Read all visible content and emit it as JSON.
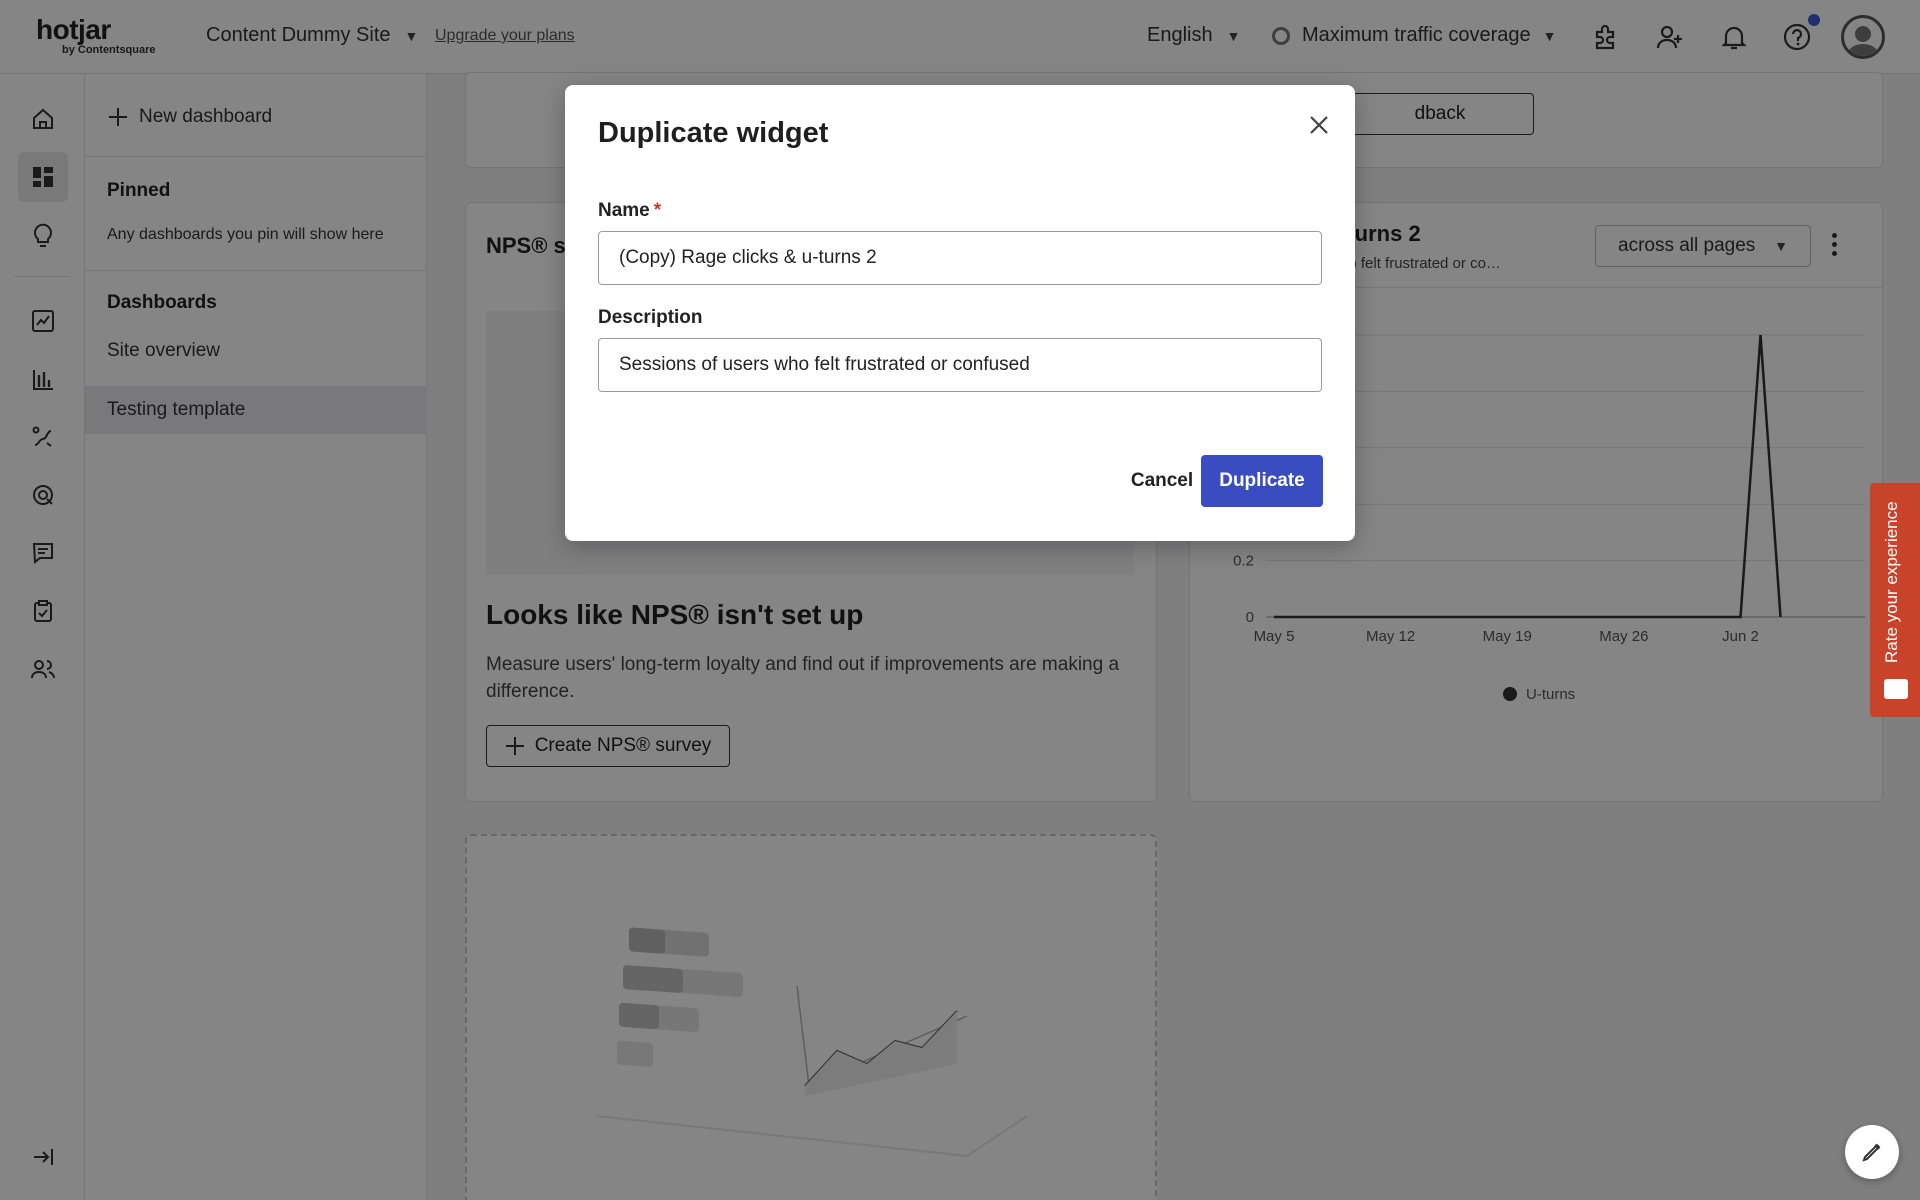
{
  "app": {
    "logo_word": "hotjar",
    "logo_sub": "by Contentsquare",
    "site_name": "Content Dummy Site",
    "upgrade_link": "Upgrade your plans",
    "language": "English",
    "traffic": "Maximum traffic coverage"
  },
  "panel": {
    "new_dashboard": "New dashboard",
    "pinned_heading": "Pinned",
    "pinned_note": "Any dashboards you pin will show here",
    "dashboards_heading": "Dashboards",
    "items": [
      {
        "label": "Site overview"
      },
      {
        "label": "Testing template"
      }
    ]
  },
  "main": {
    "feedback_button_partial": "dback",
    "nps_card": {
      "title_partial": "NPS® su",
      "heading": "Looks like NPS® isn't set up",
      "body": "Measure users' long-term loyalty and find out if improvements are making a difference.",
      "cta": "Create NPS® survey"
    },
    "chart_card": {
      "title_partial": "-turns 2",
      "subtitle_partial": "ho felt frustrated or co…",
      "scope": "across all pages"
    }
  },
  "chart_data": {
    "type": "line",
    "x": [
      "May 5",
      "May 12",
      "May 19",
      "May 26",
      "Jun 2"
    ],
    "series": [
      {
        "name": "U-turns",
        "points": [
          {
            "x": "May 5",
            "y": 0
          },
          {
            "x": "May 12",
            "y": 0
          },
          {
            "x": "May 19",
            "y": 0
          },
          {
            "x": "May 26",
            "y": 0
          },
          {
            "x": "Jun 2",
            "y": 0
          },
          {
            "x": "Jun 3",
            "y": 1
          },
          {
            "x": "Jun 4",
            "y": 0
          }
        ]
      }
    ],
    "y_ticks_visible": [
      "0",
      "0.2"
    ],
    "ylim": [
      0,
      1
    ],
    "legend": "bottom",
    "grid": true,
    "line_color": "#333333"
  },
  "modal": {
    "title": "Duplicate widget",
    "name_label": "Name",
    "required_mark": "*",
    "name_value": "(Copy) Rage clicks & u-turns 2",
    "description_label": "Description",
    "description_value": "Sessions of users who felt frustrated or confused",
    "cancel": "Cancel",
    "confirm": "Duplicate"
  },
  "feedback_tab": {
    "label": "Rate your experience",
    "color": "#c9432a"
  },
  "colors": {
    "primary": "#3a4cc2",
    "active_nav": "#e9e9ec"
  }
}
